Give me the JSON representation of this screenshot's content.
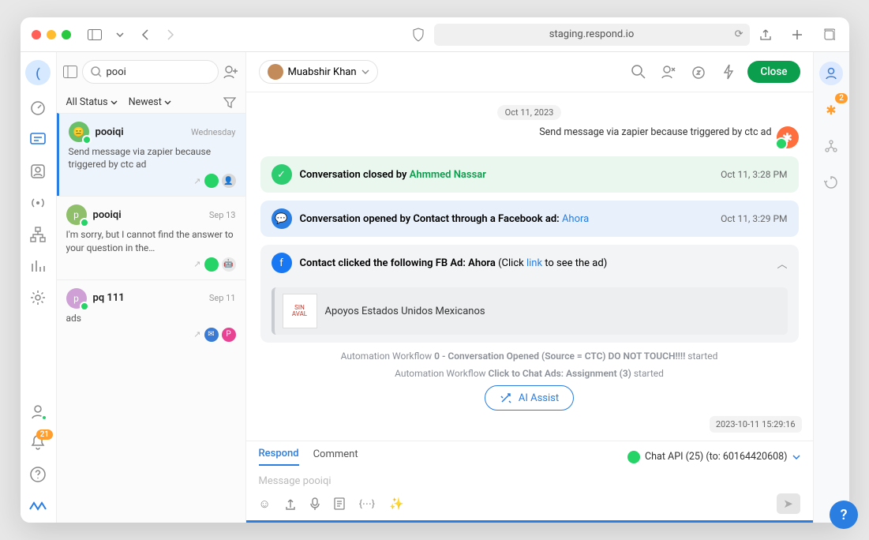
{
  "browser": {
    "url": "staging.respond.io"
  },
  "nav": {
    "brand_letter": "(",
    "notifications_badge": "21"
  },
  "inbox": {
    "search_value": "pooi",
    "filters": {
      "status": "All Status",
      "sort": "Newest"
    },
    "items": [
      {
        "name": "pooiqi",
        "time": "Wednesday",
        "preview": "Send message via zapier because triggered by ctc ad"
      },
      {
        "name": "pooiqi",
        "time": "Sep 13",
        "preview": "I'm sorry, but I cannot find the answer to your question in the…"
      },
      {
        "name": "pq 111",
        "time": "Sep 11",
        "preview": "ads"
      }
    ]
  },
  "header": {
    "assignee": "Muabshir Khan",
    "close_label": "Close"
  },
  "thread": {
    "date_pill": "Oct 11, 2023",
    "outgoing": "Send message via zapier because triggered by ctc ad",
    "ev_closed_prefix": "Conversation closed by ",
    "ev_closed_name": "Ahmmed Nassar",
    "ev_closed_time": "Oct 11, 3:28 PM",
    "ev_opened_text": "Conversation opened by Contact through a Facebook ad: ",
    "ev_opened_link": "Ahora",
    "ev_opened_time": "Oct 11, 3:29 PM",
    "ev_fb_text": "Contact clicked the following FB Ad: Ahora ",
    "ev_fb_click": "(Click ",
    "ev_fb_link": "link",
    "ev_fb_after": " to see the ad)",
    "ad_title": "Apoyos Estados Unidos Mexicanos",
    "auto1_pre": "Automation Workflow ",
    "auto1_bold": "0 - Conversation Opened (Source = CTC) DO NOT TOUCH!!!!",
    "auto1_post": " started",
    "auto2_pre": "Automation Workflow ",
    "auto2_bold": "Click to Chat Ads: Assignment (3)",
    "auto2_post": " started",
    "ai_assist": "AI Assist",
    "timestamp_box": "2023-10-11 15:29:16"
  },
  "composer": {
    "tab_respond": "Respond",
    "tab_comment": "Comment",
    "channel_label": "Chat API (25) (to: 60164420608)",
    "placeholder": "Message pooiqi"
  },
  "rside": {
    "zap_badge": "2"
  }
}
